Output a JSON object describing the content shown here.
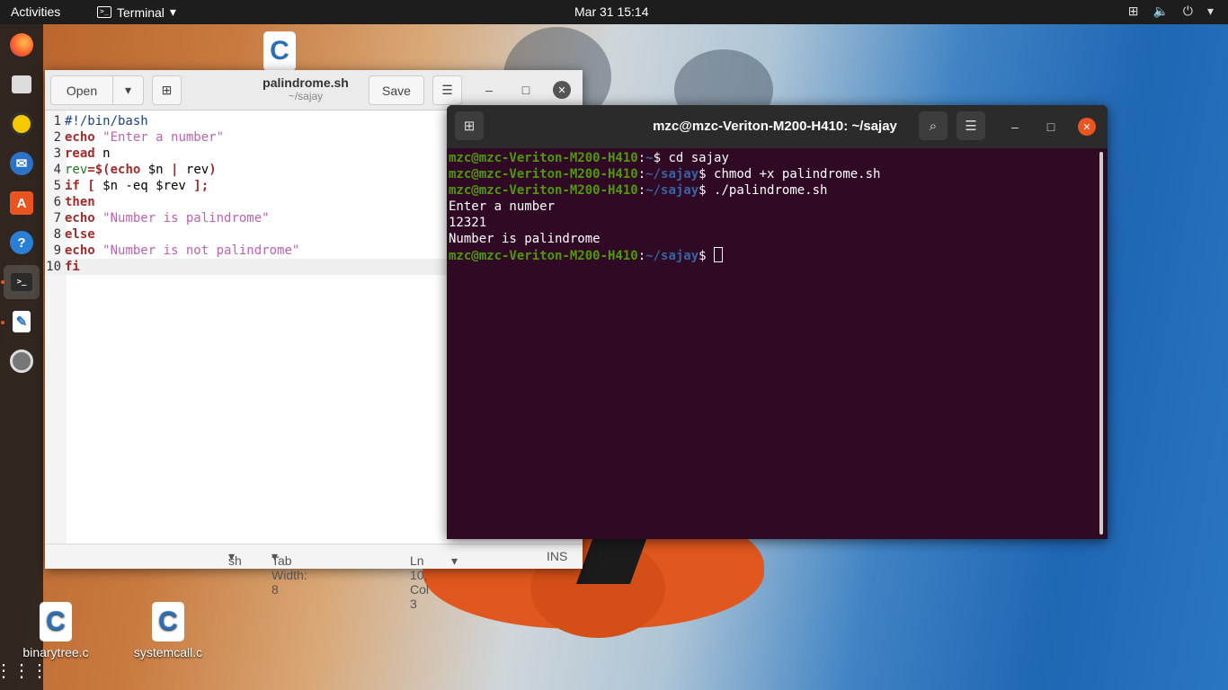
{
  "topbar": {
    "activities": "Activities",
    "app_name": "Terminal",
    "clock": "Mar 31  15:14"
  },
  "desktop": {
    "icons": [
      {
        "label": "binarytree.c"
      },
      {
        "label": "systemcall.c"
      }
    ]
  },
  "gedit": {
    "open_label": "Open",
    "save_label": "Save",
    "title": "palindrome.sh",
    "subtitle": "~/sajay",
    "lines": [
      {
        "n": "1"
      },
      {
        "n": "2"
      },
      {
        "n": "3"
      },
      {
        "n": "4"
      },
      {
        "n": "5"
      },
      {
        "n": "6"
      },
      {
        "n": "7"
      },
      {
        "n": "8"
      },
      {
        "n": "9"
      },
      {
        "n": "10"
      }
    ],
    "code": {
      "l1": "#!/bin/bash",
      "l2_kw": "echo",
      "l2_str": "\"Enter a number\"",
      "l3_kw": "read",
      "l3_rest": " n",
      "l4_var": "rev",
      "l4_a": "=$(",
      "l4_kw": "echo",
      "l4_b": " $n ",
      "l4_pipe": "|",
      "l4_c": " rev",
      "l4_d": ")",
      "l5_kw": "if",
      "l5_a": " [",
      "l5_b": " $n -eq $rev ",
      "l5_c": "];",
      "l6_kw": "then",
      "l7_kw": "echo",
      "l7_str": "\"Number is palindrome\"",
      "l8_kw": "else",
      "l9_kw": "echo",
      "l9_str": "\"Number is not palindrome\"",
      "l10_kw": "fi"
    },
    "status": {
      "language": "sh",
      "tab_width": "Tab Width: 8",
      "position": "Ln 10, Col 3",
      "mode": "INS"
    }
  },
  "terminal": {
    "title": "mzc@mzc-Veriton-M200-H410: ~/sajay",
    "user_host": "mzc@mzc-Veriton-M200-H410",
    "lines": [
      {
        "path": "~",
        "cmd": "$ cd sajay"
      },
      {
        "path": "~/sajay",
        "cmd": "$ chmod +x palindrome.sh"
      },
      {
        "path": "~/sajay",
        "cmd": "$ ./palindrome.sh"
      }
    ],
    "output": [
      "Enter a number",
      "12321",
      "Number is palindrome"
    ],
    "last_prompt": {
      "path": "~/sajay",
      "cmd": "$ "
    }
  },
  "colors": {
    "terminal_bg": "#300a24",
    "prompt_user": "#4e9a06",
    "prompt_path": "#3465a4",
    "accent": "#e95420"
  }
}
